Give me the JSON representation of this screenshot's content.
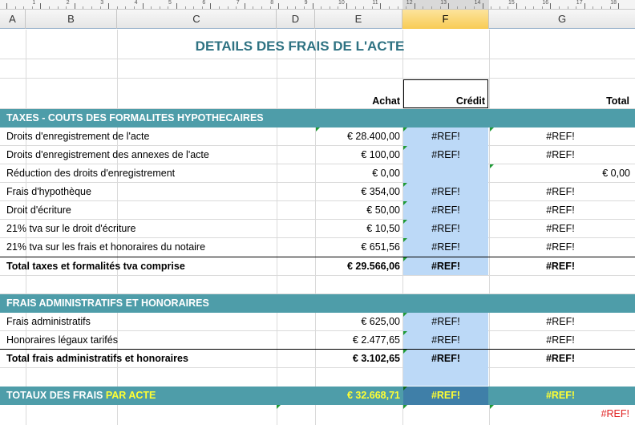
{
  "columns": [
    "A",
    "B",
    "C",
    "D",
    "E",
    "F",
    "G"
  ],
  "ruler_numbers": [
    "1",
    "2",
    "3",
    "4",
    "5",
    "6",
    "7",
    "8",
    "9",
    "10",
    "11",
    "12",
    "13",
    "14",
    "15",
    "16",
    "17",
    "18"
  ],
  "title": "DETAILS DES FRAIS DE L'ACTE",
  "headers": {
    "achat": "Achat",
    "credit": "Crédit",
    "total": "Total"
  },
  "section1": {
    "title": "TAXES - COUTS DES FORMALITES HYPOTHECAIRES",
    "rows": [
      {
        "label": "Droits d'enregistrement de l'acte",
        "achat": "€ 28.400,00",
        "credit": "#REF!",
        "total": "#REF!"
      },
      {
        "label": "Droits d'enregistrement des annexes de l'acte",
        "achat": "€ 100,00",
        "credit": "#REF!",
        "total": "#REF!"
      },
      {
        "label": "Réduction des droits d'enregistrement",
        "achat": "€ 0,00",
        "credit": "",
        "total": "€ 0,00"
      },
      {
        "label": "Frais d'hypothèque",
        "achat": "€ 354,00",
        "credit": "#REF!",
        "total": "#REF!"
      },
      {
        "label": "Droit d'écriture",
        "achat": "€ 50,00",
        "credit": "#REF!",
        "total": "#REF!"
      },
      {
        "label": "21% tva sur le droit d'écriture",
        "achat": "€ 10,50",
        "credit": "#REF!",
        "total": "#REF!"
      },
      {
        "label": "21% tva sur les frais et honoraires du notaire",
        "achat": "€ 651,56",
        "credit": "#REF!",
        "total": "#REF!"
      }
    ],
    "total": {
      "label": "Total taxes et formalités tva comprise",
      "achat": "€ 29.566,06",
      "credit": "#REF!",
      "total": "#REF!"
    }
  },
  "section2": {
    "title": "FRAIS ADMINISTRATIFS ET HONORAIRES",
    "rows": [
      {
        "label": "Frais administratifs",
        "achat": "€ 625,00",
        "credit": "#REF!",
        "total": "#REF!"
      },
      {
        "label": "Honoraires légaux tarifés",
        "achat": "€ 2.477,65",
        "credit": "#REF!",
        "total": "#REF!"
      }
    ],
    "total": {
      "label": "Total frais administratifs et honoraires",
      "achat": "€ 3.102,65",
      "credit": "#REF!",
      "total": "#REF!"
    }
  },
  "grand_total": {
    "label_part1": "TOTAUX DES FRAIS ",
    "label_part2": "PAR ACTE",
    "achat": "€ 32.668,71",
    "credit": "#REF!",
    "total": "#REF!"
  },
  "footer_ref": "#REF!",
  "colors": {
    "band": "#4e9da9",
    "title": "#2e7282",
    "credit_fill": "#bcd9f7",
    "credit_total_fill": "#3f7fa8",
    "error_red": "#e02020",
    "highlight_yellow": "#ffff33",
    "marker_green": "#1e9a35"
  }
}
